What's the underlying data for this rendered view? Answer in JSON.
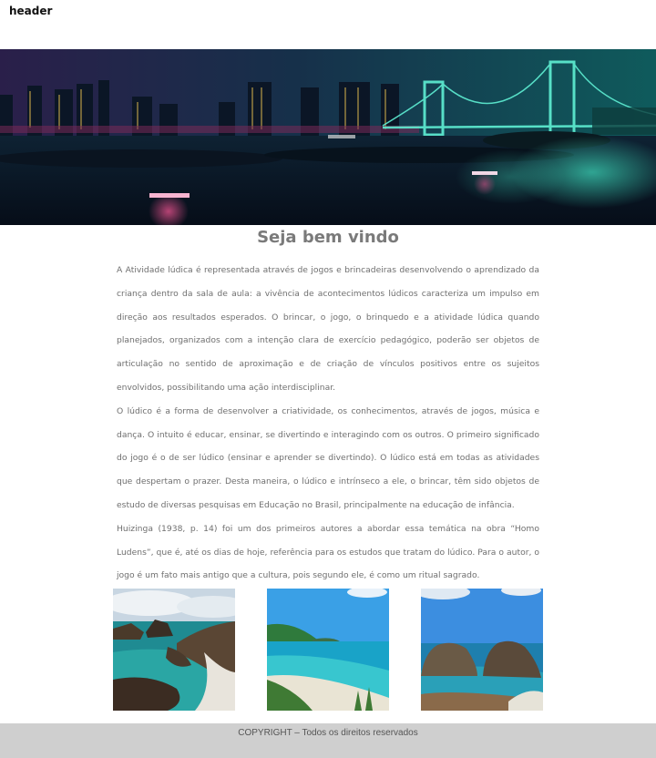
{
  "header": {
    "label": "header"
  },
  "main": {
    "title": "Seja bem vindo",
    "paragraphs": [
      "A Atividade lúdica é representada através de jogos e brincadeiras desenvolvendo o aprendizado da criança dentro da sala de aula: a vivência de acontecimentos lúdicos caracteriza um impulso em direção aos resultados esperados. O brincar, o jogo, o brinquedo e a atividade lúdica quando planejados, organizados com a intenção clara de exercício pedagógico, poderão ser objetos de articulação no sentido de aproximação e de criação de vínculos positivos entre os sujeitos envolvidos, possibilitando uma ação interdisciplinar.",
      "O lúdico é a forma de desenvolver a criatividade, os conhecimentos, através de jogos, música e dança. O intuito é educar, ensinar, se divertindo e interagindo com os outros. O primeiro significado do jogo é o de ser lúdico (ensinar e aprender se divertindo). O lúdico está em todas as atividades que despertam o prazer. Desta maneira, o lúdico e intrínseco a ele, o brincar, têm sido objetos de estudo de diversas pesquisas em Educação no Brasil, principalmente na educação de infância.",
      "Huizinga (1938, p. 14) foi um dos primeiros autores a abordar essa temática na obra “Homo Ludens”, que é, até os dias de hoje, referência para os estudos que tratam do lúdico. Para o autor, o jogo é um fato mais antigo que a cultura, pois segundo ele, é como um ritual sagrado."
    ]
  },
  "footer": {
    "copyright": "COPYRIGHT – Todos os direitos reservados"
  }
}
